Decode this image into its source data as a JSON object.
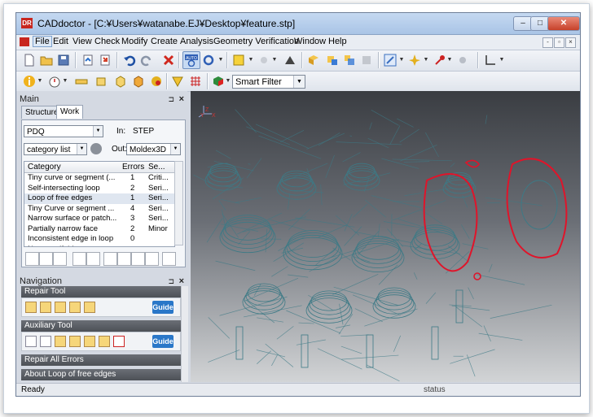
{
  "window": {
    "title": "CADdoctor - [C:¥Users¥watanabe.EJ¥Desktop¥feature.stp]",
    "app_logo": "DR",
    "controls": {
      "minimize": "‒",
      "maximize": "□",
      "close": "✕"
    }
  },
  "menu": {
    "items": [
      "File",
      "Edit",
      "View",
      "Check",
      "Modify",
      "Create",
      "Analysis",
      "Geometry Verification",
      "Window",
      "Help"
    ],
    "active": "File",
    "mdi_controls": [
      "-",
      "▫",
      "×"
    ]
  },
  "toolbar": {
    "smart_filter": "Smart Filter",
    "auto_label": "AUTO"
  },
  "main_pane": {
    "title": "Main",
    "pin": "⊐",
    "close": "×",
    "tabs": [
      "Structure",
      "Work"
    ],
    "selected_tab": "Work",
    "pdq_value": "PDQ",
    "in_label": "In:",
    "in_value": "STEP",
    "category_combo": "category list",
    "out_label": "Out:",
    "out_value": "Moldex3D",
    "columns": [
      "Category",
      "Errors",
      "Se..."
    ],
    "rows": [
      {
        "category": "Tiny curve or segment (...",
        "errors": "1",
        "severity": "Criti..."
      },
      {
        "category": "Self-intersecting loop",
        "errors": "2",
        "severity": "Seri..."
      },
      {
        "category": "Loop of free edges",
        "errors": "1",
        "severity": "Seri..."
      },
      {
        "category": "Tiny Curve or segment ...",
        "errors": "4",
        "severity": "Seri..."
      },
      {
        "category": "Narrow surface or patch...",
        "errors": "3",
        "severity": "Seri..."
      },
      {
        "category": "Partially narrow face",
        "errors": "2",
        "severity": "Minor"
      },
      {
        "category": "Inconsistent edge in loop",
        "errors": "0",
        "severity": ""
      },
      {
        "category": "Non-manifold...",
        "errors": "",
        "severity": ""
      }
    ],
    "selected_row": 2
  },
  "navigation": {
    "title": "Navigation",
    "pin": "⊐",
    "close": "×",
    "sections": [
      {
        "label": "Repair Tool",
        "expanded": true,
        "guide": "Guide"
      },
      {
        "label": "Auxiliary Tool",
        "expanded": true,
        "guide": "Guide"
      },
      {
        "label": "Repair All Errors",
        "expanded": false
      },
      {
        "label": "About Loop of free edges",
        "expanded": false
      }
    ]
  },
  "viewport": {
    "axis_labels": [
      "Z",
      "Y",
      "X"
    ]
  },
  "status": {
    "left": "Ready",
    "middle": "status"
  },
  "colors": {
    "highlight_red": "#e0142a",
    "wire": "#3d7a86",
    "guide_blue": "#2a77c8"
  }
}
